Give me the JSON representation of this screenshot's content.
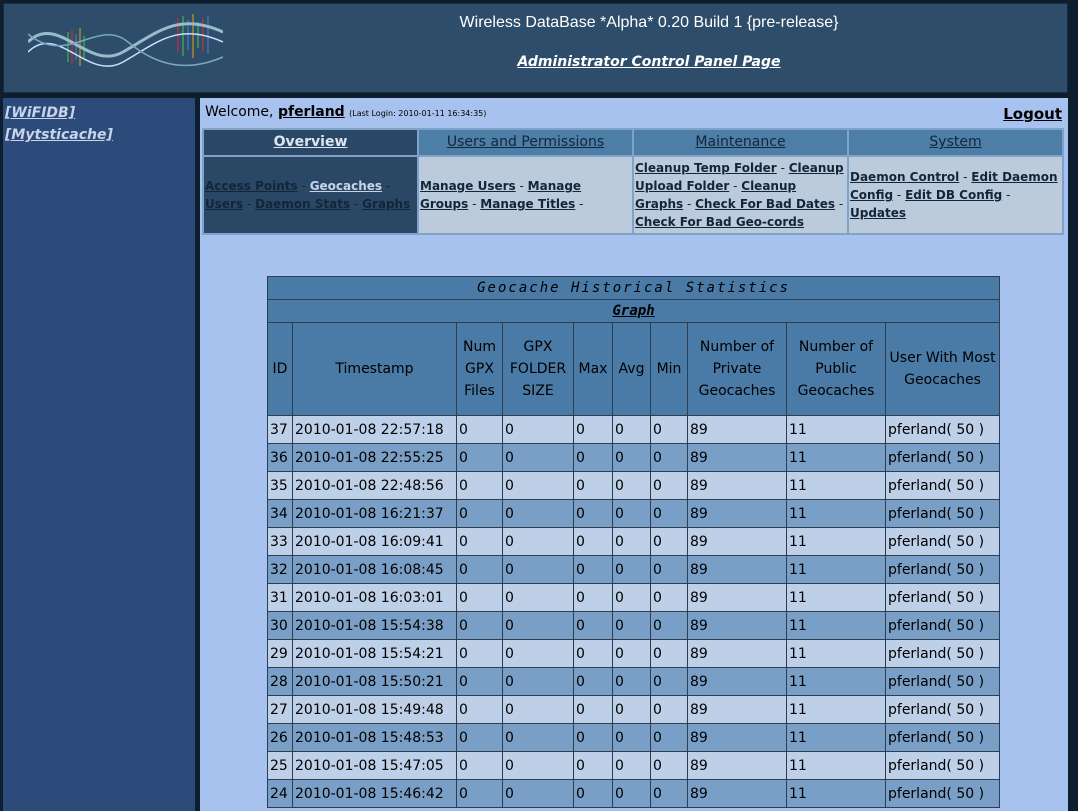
{
  "header": {
    "logo_alt": "Random Intervals",
    "app_title": "Wireless DataBase *Alpha* 0.20 Build 1 {pre-release}",
    "control_panel_link": "Administrator Control Panel Page"
  },
  "sidebar": {
    "items": [
      {
        "label": "[WiFIDB]"
      },
      {
        "label": "[Mytsticache]"
      }
    ]
  },
  "welcome": {
    "prefix": "Welcome, ",
    "user": "pferland",
    "last_login": "(Last Login: 2010-01-11 16:34:35)",
    "logout": "Logout"
  },
  "nav": {
    "tabs": [
      {
        "label": "Overview",
        "active": true
      },
      {
        "label": "Users and Permissions",
        "active": false
      },
      {
        "label": "Maintenance",
        "active": false
      },
      {
        "label": "System",
        "active": false
      }
    ],
    "overview_links": [
      "Access Points",
      "Geocaches",
      "Users",
      "Daemon Stats",
      "Graphs"
    ],
    "users_links": [
      "Manage Users",
      "Manage Groups",
      "Manage Titles"
    ],
    "maintenance_links": [
      "Cleanup Temp Folder",
      "Cleanup Upload Folder",
      "Cleanup Graphs",
      "Check For Bad Dates",
      "Check For Bad Geo-cords"
    ],
    "system_links": [
      "Daemon Control",
      "Edit Daemon Config",
      "Edit DB Config",
      "Updates"
    ]
  },
  "stats": {
    "caption": "Geocache Historical Statistics",
    "graph_link": "Graph",
    "columns": {
      "id": "ID",
      "timestamp": "Timestamp",
      "num_gpx_files": "Num GPX Files",
      "gpx_folder_size": "GPX FOLDER SIZE",
      "max": "Max",
      "avg": "Avg",
      "min": "Min",
      "num_private": "Number of Private Geocaches",
      "num_public": "Number of Public Geocaches",
      "user_most": "User With Most Geocaches"
    },
    "rows": [
      [
        "37",
        "2010-01-08 22:57:18",
        "0",
        "0",
        "0",
        "0",
        "0",
        "89",
        "11",
        "pferland( 50 )"
      ],
      [
        "36",
        "2010-01-08 22:55:25",
        "0",
        "0",
        "0",
        "0",
        "0",
        "89",
        "11",
        "pferland( 50 )"
      ],
      [
        "35",
        "2010-01-08 22:48:56",
        "0",
        "0",
        "0",
        "0",
        "0",
        "89",
        "11",
        "pferland( 50 )"
      ],
      [
        "34",
        "2010-01-08 16:21:37",
        "0",
        "0",
        "0",
        "0",
        "0",
        "89",
        "11",
        "pferland( 50 )"
      ],
      [
        "33",
        "2010-01-08 16:09:41",
        "0",
        "0",
        "0",
        "0",
        "0",
        "89",
        "11",
        "pferland( 50 )"
      ],
      [
        "32",
        "2010-01-08 16:08:45",
        "0",
        "0",
        "0",
        "0",
        "0",
        "89",
        "11",
        "pferland( 50 )"
      ],
      [
        "31",
        "2010-01-08 16:03:01",
        "0",
        "0",
        "0",
        "0",
        "0",
        "89",
        "11",
        "pferland( 50 )"
      ],
      [
        "30",
        "2010-01-08 15:54:38",
        "0",
        "0",
        "0",
        "0",
        "0",
        "89",
        "11",
        "pferland( 50 )"
      ],
      [
        "29",
        "2010-01-08 15:54:21",
        "0",
        "0",
        "0",
        "0",
        "0",
        "89",
        "11",
        "pferland( 50 )"
      ],
      [
        "28",
        "2010-01-08 15:50:21",
        "0",
        "0",
        "0",
        "0",
        "0",
        "89",
        "11",
        "pferland( 50 )"
      ],
      [
        "27",
        "2010-01-08 15:49:48",
        "0",
        "0",
        "0",
        "0",
        "0",
        "89",
        "11",
        "pferland( 50 )"
      ],
      [
        "26",
        "2010-01-08 15:48:53",
        "0",
        "0",
        "0",
        "0",
        "0",
        "89",
        "11",
        "pferland( 50 )"
      ],
      [
        "25",
        "2010-01-08 15:47:05",
        "0",
        "0",
        "0",
        "0",
        "0",
        "89",
        "11",
        "pferland( 50 )"
      ],
      [
        "24",
        "2010-01-08 15:46:42",
        "0",
        "0",
        "0",
        "0",
        "0",
        "89",
        "11",
        "pferland( 50 )"
      ]
    ]
  },
  "colors": {
    "header_bg": "#2e4d6b",
    "sidebar_bg": "#2d4b7a",
    "main_bg": "#a8c2ef",
    "table_header_bg": "#4a7aa6",
    "row_light": "#bdd0e7",
    "row_dark": "#7a9fc6"
  }
}
